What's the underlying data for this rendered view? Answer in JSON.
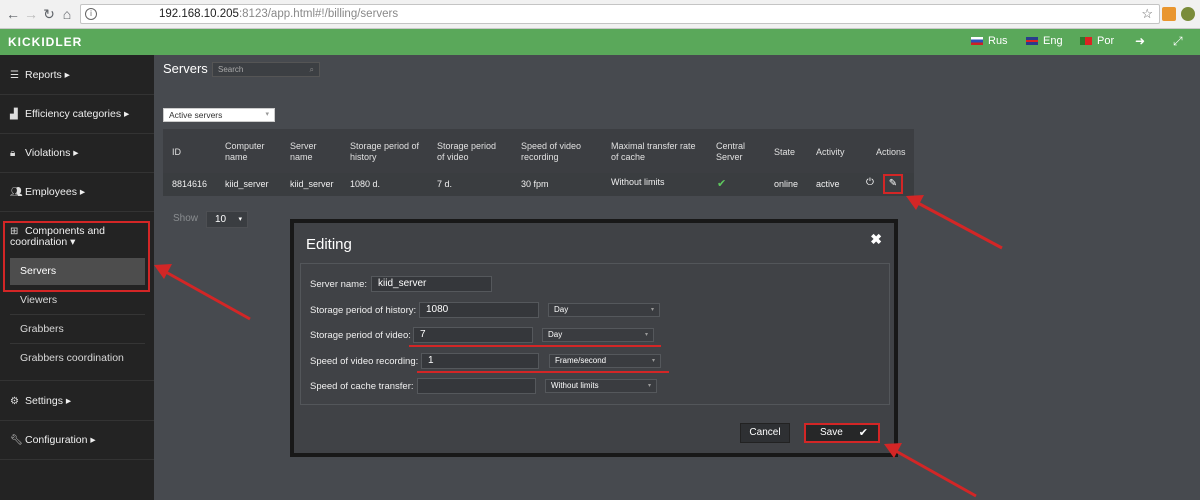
{
  "browser": {
    "url_host": "192.168.10.205",
    "url_rest": ":8123/app.html#!/billing/servers"
  },
  "header": {
    "logo": "KICKIDLER",
    "langs": [
      "Rus",
      "Eng",
      "Por"
    ]
  },
  "sidebar": {
    "items": [
      {
        "label": "Reports",
        "icon": "list-icon"
      },
      {
        "label": "Efficiency categories",
        "icon": "bar-chart-icon"
      },
      {
        "label": "Violations",
        "icon": "lock-icon"
      },
      {
        "label": "Employees",
        "icon": "users-icon"
      },
      {
        "label": "Components and coordination",
        "icon": "sitemap-icon"
      },
      {
        "label": "Settings",
        "icon": "gears-icon"
      },
      {
        "label": "Configuration",
        "icon": "wrench-icon"
      }
    ],
    "sub": [
      "Servers",
      "Viewers",
      "Grabbers",
      "Grabbers coordination"
    ]
  },
  "main": {
    "title": "Servers",
    "search_placeholder": "Search",
    "filter": "Active servers",
    "table": {
      "headers": [
        "ID",
        "Computer name",
        "Server name",
        "Storage period of history",
        "Storage period of video",
        "Speed of video recording",
        "Maximal transfer rate of cache",
        "Central Server",
        "State",
        "Activity",
        "Actions"
      ],
      "rows": [
        {
          "id": "8814616",
          "computer": "kiid_server",
          "server": "kiid_server",
          "history": "1080 d.",
          "video": "7 d.",
          "speed": "30 fpm",
          "cache": "Without limits",
          "state": "online",
          "activity": "active"
        }
      ]
    },
    "show_label": "Show",
    "show_value": "10"
  },
  "modal": {
    "title": "Editing",
    "fields": {
      "server_name_label": "Server name:",
      "server_name": "kiid_server",
      "history_label": "Storage period of history:",
      "history_value": "1080",
      "history_unit": "Day",
      "video_label": "Storage period of video:",
      "video_value": "7",
      "video_unit": "Day",
      "speed_label": "Speed of video recording:",
      "speed_value": "1",
      "speed_unit": "Frame/second",
      "cache_label": "Speed of cache transfer:",
      "cache_value": "",
      "cache_unit": "Without limits"
    },
    "cancel": "Cancel",
    "save": "Save"
  },
  "colors": {
    "accent_green": "#5aa85a",
    "highlight_red": "#d32626",
    "sidebar_bg": "#232323"
  }
}
